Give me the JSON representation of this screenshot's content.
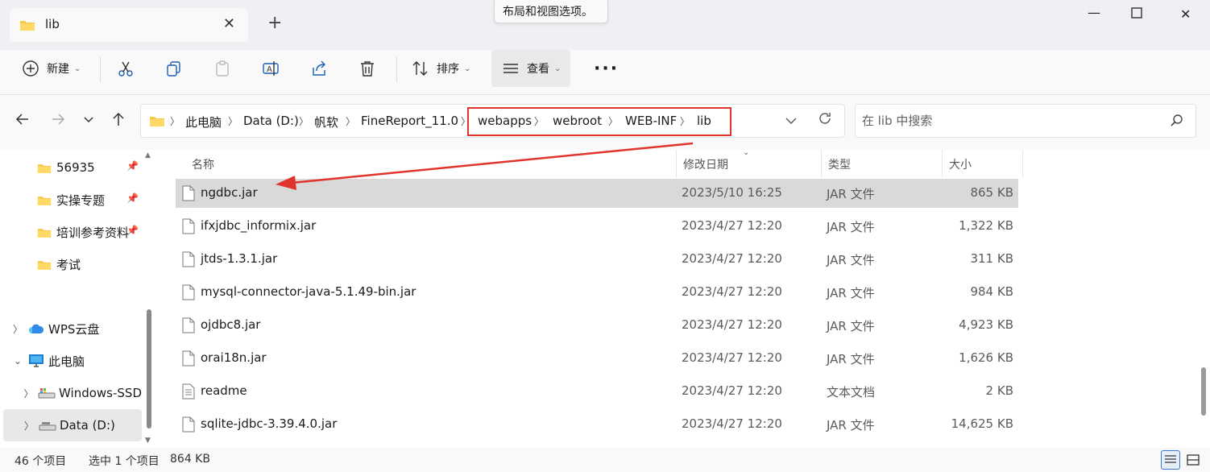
{
  "window": {
    "tab_title": "lib",
    "tooltip": "布局和视图选项。"
  },
  "toolbar": {
    "new_label": "新建",
    "sort_label": "排序",
    "view_label": "查看"
  },
  "address": {
    "crumbs": [
      "此电脑",
      "Data (D:)",
      "帆软",
      "FineReport_11.0",
      "webapps",
      "webroot",
      "WEB-INF",
      "lib"
    ],
    "highlight_color": "#e0342c"
  },
  "search": {
    "placeholder": "在 lib 中搜索"
  },
  "navpane": {
    "items": [
      {
        "label": "56935",
        "icon": "folder-icon",
        "pinned": true
      },
      {
        "label": "实操专题",
        "icon": "folder-icon",
        "pinned": true
      },
      {
        "label": "培训参考资料",
        "icon": "folder-icon",
        "pinned": true
      },
      {
        "label": "考试",
        "icon": "folder-icon",
        "pinned": false
      },
      {
        "label": "WPS云盘",
        "icon": "cloud-icon",
        "expand": "collapsed"
      },
      {
        "label": "此电脑",
        "icon": "computer-icon",
        "expand": "expanded"
      },
      {
        "label": "Windows-SSD",
        "icon": "drive-icon",
        "expand": "collapsed"
      },
      {
        "label": "Data (D:)",
        "icon": "drive-icon",
        "expand": "collapsed",
        "selected": true
      }
    ]
  },
  "columns": {
    "name": "名称",
    "date": "修改日期",
    "type": "类型",
    "size": "大小"
  },
  "files": [
    {
      "name": "ngdbc.jar",
      "date": "2023/5/10 16:25",
      "type": "JAR 文件",
      "size": "865 KB",
      "selected": true
    },
    {
      "name": "ifxjdbc_informix.jar",
      "date": "2023/4/27 12:20",
      "type": "JAR 文件",
      "size": "1,322 KB"
    },
    {
      "name": "jtds-1.3.1.jar",
      "date": "2023/4/27 12:20",
      "type": "JAR 文件",
      "size": "311 KB"
    },
    {
      "name": "mysql-connector-java-5.1.49-bin.jar",
      "date": "2023/4/27 12:20",
      "type": "JAR 文件",
      "size": "984 KB"
    },
    {
      "name": "ojdbc8.jar",
      "date": "2023/4/27 12:20",
      "type": "JAR 文件",
      "size": "4,923 KB"
    },
    {
      "name": "orai18n.jar",
      "date": "2023/4/27 12:20",
      "type": "JAR 文件",
      "size": "1,626 KB"
    },
    {
      "name": "readme",
      "date": "2023/4/27 12:20",
      "type": "文本文档",
      "size": "2 KB"
    },
    {
      "name": "sqlite-jdbc-3.39.4.0.jar",
      "date": "2023/4/27 12:20",
      "type": "JAR 文件",
      "size": "14,625 KB"
    }
  ],
  "status": {
    "count": "46 个项目",
    "selection": "选中 1 个项目",
    "selection_size": "864 KB"
  }
}
